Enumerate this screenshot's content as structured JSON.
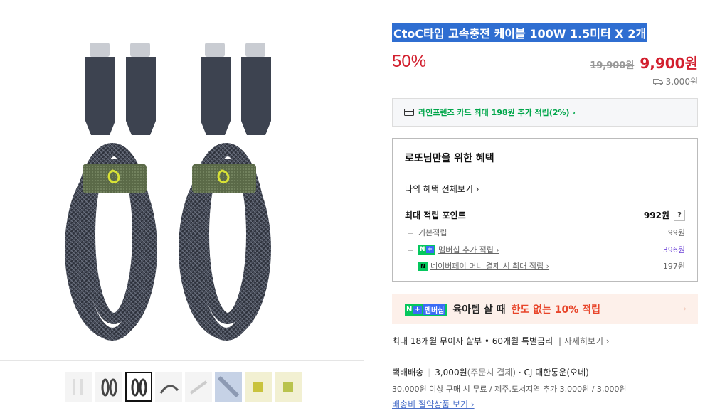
{
  "product": {
    "title": "CtoC타입 고속충전 케이블 100W 1.5미터 X 2개",
    "discount": "50%",
    "original_price": "19,900원",
    "sale_price": "9,900원",
    "shipping_fee": "3,000원"
  },
  "card_promo": "라인프렌즈 카드 최대 198원 추가 적립(2%) ›",
  "benefit": {
    "heading": "로또님만을 위한 혜택",
    "view_all": "나의 혜택 전체보기 ›",
    "max_points_label": "최대 적립 포인트",
    "max_points_value": "992원",
    "help": "?",
    "rows": [
      {
        "label": "기본적립",
        "value": "99원"
      },
      {
        "label": "멤버십 추가 적립 ›",
        "value": "396원"
      },
      {
        "label": "네이버페이 머니 결제 시 최대 적립 ›",
        "value": "197원"
      }
    ],
    "nplus_badge_n": "N",
    "nplus_badge_plus": "+",
    "npay_badge": "N"
  },
  "banner": {
    "badge_n": "N",
    "badge_plus": "+",
    "badge_text": "멤버십",
    "main": "육아템 살 때",
    "accent": "한도 없는 10% 적립",
    "chevron": "›"
  },
  "installment": {
    "text": "최대 18개월 무이자 할부 • 60개월 특별금리",
    "more": "| 자세히보기 ›"
  },
  "shipping": {
    "type": "택배배송",
    "fee": "3,000원",
    "fee_note": "(주문시 결제)",
    "carrier": "CJ 대한통운(오네)",
    "conditions": "30,000원 이상 구매 시 무료 / 제주,도서지역 추가 3,000원 / 3,000원",
    "bundle_link": "배송비 절약상품 보기 ›"
  },
  "colors": {
    "accent_red": "#d21f2e",
    "naver_green": "#05c75d",
    "title_highlight": "#2f6ed1"
  }
}
